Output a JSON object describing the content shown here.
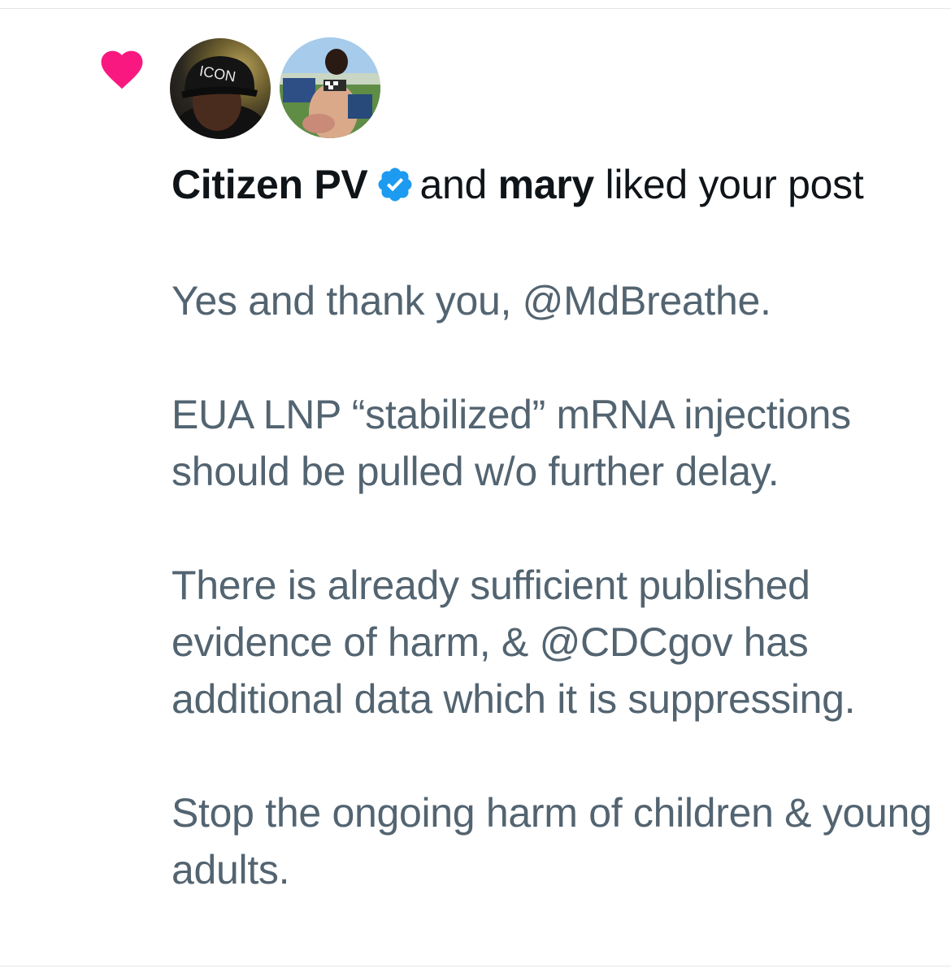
{
  "notification": {
    "actor_1": "Citizen PV",
    "connector": "and",
    "actor_2": "mary",
    "action": "liked your post",
    "icon": "heart-icon",
    "heart_color": "#f91880",
    "verified_color": "#1d9bf0"
  },
  "avatars": [
    {
      "alt": "ICON",
      "icon": "avatar-photo"
    },
    {
      "alt": "",
      "icon": "avatar-photo"
    }
  ],
  "post": {
    "paragraphs": [
      "Yes and thank you, @MdBreathe.",
      "EUA LNP “stabilized” mRNA injections should be pulled w/o further delay.",
      "There is already sufficient published evidence of harm, & @CDCgov has additional data which it is suppressing.",
      "Stop the ongoing harm of children & young adults."
    ]
  }
}
